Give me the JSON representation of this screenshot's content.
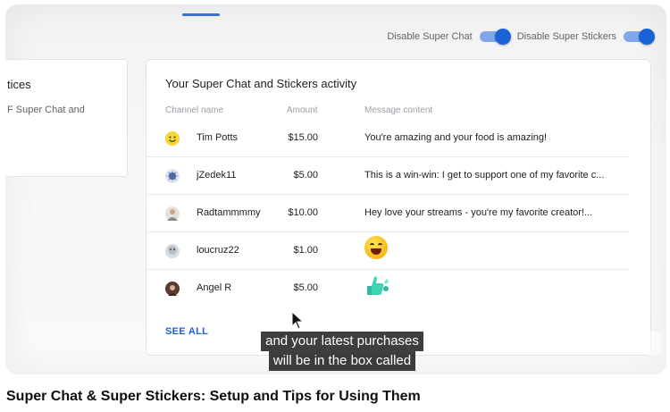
{
  "toggles": {
    "super_chat_label": "Disable Super Chat",
    "super_stickers_label": "Disable Super Stickers"
  },
  "left_card": {
    "title_fragment": "tices",
    "body_fragment": "F Super Chat and"
  },
  "activity": {
    "title": "Your Super Chat and Stickers activity",
    "columns": [
      "Channel name",
      "Amount",
      "Message content"
    ],
    "rows": [
      {
        "name": "Tim Potts",
        "amount": "$15.00",
        "message": "You're amazing and your food is amazing!"
      },
      {
        "name": "jZedek11",
        "amount": "$5.00",
        "message": "This is a win-win: I get to support one of my favorite c..."
      },
      {
        "name": "Radtammmmy",
        "amount": "$10.00",
        "message": "Hey love your streams - you're my favorite creator!..."
      },
      {
        "name": "loucruz22",
        "amount": "$1.00",
        "message": "",
        "sticker": "laughing-face-sticker"
      },
      {
        "name": "Angel R",
        "amount": "$5.00",
        "message": "",
        "sticker": "thumbs-up-sticker"
      }
    ],
    "see_all": "SEE ALL"
  },
  "caption": {
    "line1": "and your latest purchases",
    "line2": "will be in the box called"
  },
  "video_title": "Super Chat & Super Stickers: Setup and Tips for Using Them",
  "colors": {
    "accent": "#1a63d7",
    "toggle_track": "#7fa7ea"
  }
}
